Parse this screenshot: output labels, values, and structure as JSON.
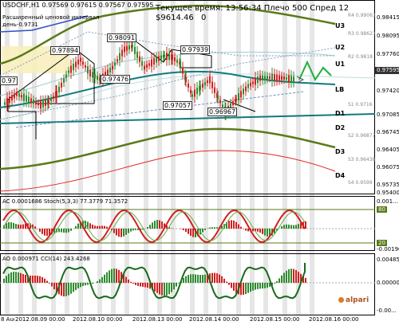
{
  "header": {
    "symbol_line": "USDCHF,H1  0.97569 0.97615 0.97567 0.97595",
    "indicator_name": "Расширенный ценовой интервал",
    "indicator_params": "день-0.9731",
    "time_info": "Текущее время: 13:56:34  Плечо 500  Спред 12",
    "balance": "$9614.46",
    "balance_extra": "0"
  },
  "price_tags": [
    "0.97894",
    "0.98091",
    "0.97476",
    "0.97939",
    "0.97057",
    "0.96967",
    "0.97"
  ],
  "levels": {
    "u3": "U3",
    "u2": "U2",
    "u1": "U1",
    "lb": "LB",
    "d1": "D1",
    "d2": "D2",
    "d3": "D3",
    "d4": "D4",
    "r4": "R4 0.99063",
    "r3": "R3 0.98623",
    "r2": "R2 0.9818",
    "s1": "S1 0.9716",
    "s2": "S2 0.96877",
    "s3": "S3 0.96438",
    "s4": "S4 0.9599"
  },
  "price_scale": [
    "0.98415",
    "0.98095",
    "0.97760",
    "0.97420",
    "0.97085",
    "0.96745",
    "0.96405",
    "0.96075",
    "0.95735",
    "0.95400"
  ],
  "current_price": "0.97595",
  "ac_panel": {
    "title": "AC  0.0001686  Stoch(5,3,3) 77.3779  71.3572",
    "scale": [
      "0.001...",
      "80",
      "20",
      "-0.00190"
    ]
  },
  "ao_panel": {
    "title": "AO  0.000971  CCI(14) 243.4268",
    "scale": [
      "0.00485",
      "0.00000",
      "-0.00..."
    ]
  },
  "time_labels": [
    "8 Aug 2012",
    "2012.08.09 00:00",
    "2012.08.10 00:00",
    "2012.08.13 00:00",
    "2012.08.14 00:00",
    "2012.08.15 00:00",
    "2012.08.16 00:00"
  ],
  "logo_text": "alpari",
  "colors": {
    "bull": "#2e8b2e",
    "bear": "#d02020",
    "ma_teal": "#107a7a",
    "ma_green": "#5a7a1a",
    "ma_red": "#e02828"
  }
}
